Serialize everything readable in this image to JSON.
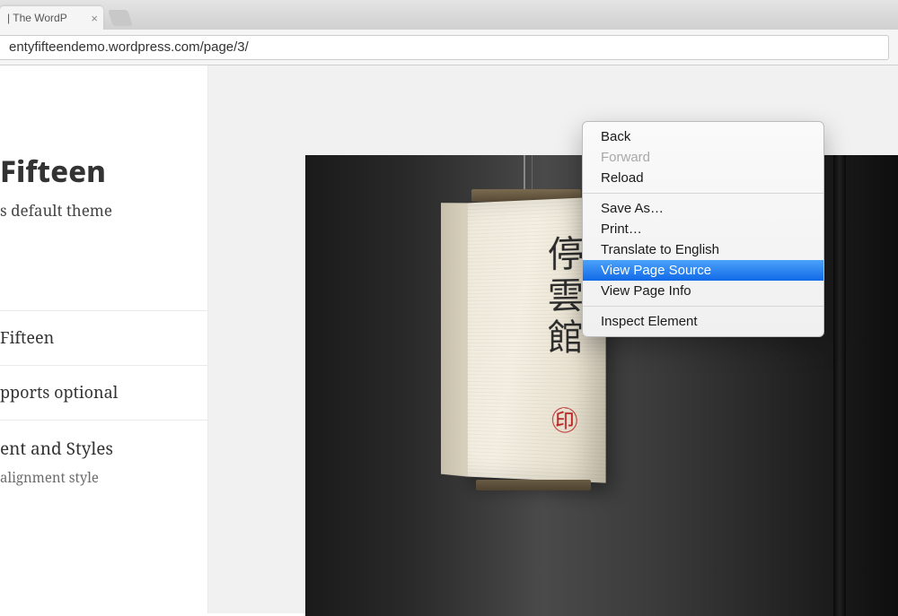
{
  "browser": {
    "tab_title": " | The WordP",
    "url": "entyfifteendemo.wordpress.com/page/3/"
  },
  "sidebar": {
    "site_title": "Fifteen",
    "site_desc": "s default theme",
    "nav1": " Fifteen",
    "nav2": "pports optional",
    "nav3_title": "ent and Styles",
    "nav3_sub": "alignment style"
  },
  "lantern": {
    "kanji": "停雲館",
    "seal": "㊞"
  },
  "context_menu": {
    "items": [
      {
        "label": "Back",
        "disabled": false
      },
      {
        "label": "Forward",
        "disabled": true
      },
      {
        "label": "Reload",
        "disabled": false
      }
    ],
    "items2": [
      {
        "label": "Save As…"
      },
      {
        "label": "Print…"
      },
      {
        "label": "Translate to English"
      },
      {
        "label": "View Page Source",
        "selected": true
      },
      {
        "label": "View Page Info"
      }
    ],
    "items3": [
      {
        "label": "Inspect Element"
      }
    ]
  }
}
